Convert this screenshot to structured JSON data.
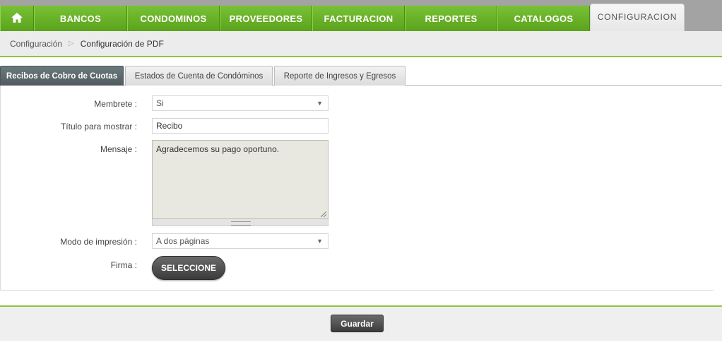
{
  "nav": {
    "home_icon": "home-icon",
    "items": [
      {
        "label": "BANCOS"
      },
      {
        "label": "CONDOMINOS"
      },
      {
        "label": "PROVEEDORES"
      },
      {
        "label": "FACTURACION"
      },
      {
        "label": "REPORTES"
      },
      {
        "label": "CATALOGOS"
      },
      {
        "label": "CONFIGURACION"
      }
    ],
    "active_index": 6,
    "accent_color": "#6cb52a"
  },
  "breadcrumb": {
    "parent": "Configuración",
    "current": "Configuración de PDF"
  },
  "tabs": [
    {
      "label": "Recibos de Cobro de Cuotas",
      "active": true
    },
    {
      "label": "Estados de Cuenta de Condóminos",
      "active": false
    },
    {
      "label": "Reporte de Ingresos y Egresos",
      "active": false
    }
  ],
  "form": {
    "membrete": {
      "label": "Membrete",
      "value": "Si"
    },
    "titulo": {
      "label": "Título para mostrar",
      "value": "Recibo"
    },
    "mensaje": {
      "label": "Mensaje",
      "value": "Agradecemos su pago oportuno."
    },
    "modo": {
      "label": "Modo de impresión",
      "value": "A dos páginas"
    },
    "firma": {
      "label": "Firma",
      "button": "SELECCIONE"
    }
  },
  "footer": {
    "save_label": "Guardar"
  }
}
